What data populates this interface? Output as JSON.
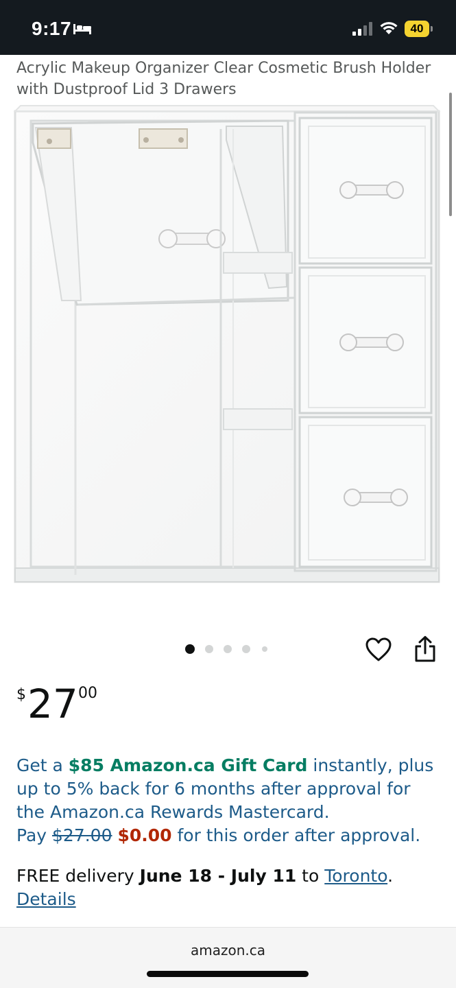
{
  "status_bar": {
    "time": "9:17",
    "battery": "40",
    "icons": [
      "bed-icon",
      "signal-icon",
      "wifi-icon",
      "battery-icon"
    ]
  },
  "product": {
    "title": "Acrylic Makeup Organizer Clear Cosmetic Brush Holder with Dustproof Lid 3 Drawers",
    "image_alt": "clear-acrylic-organizer-image",
    "carousel": {
      "total_dots": 5,
      "active_index": 0
    }
  },
  "price": {
    "symbol": "$",
    "whole": "27",
    "fraction": "00"
  },
  "promo": {
    "part1": "Get a ",
    "gift_card": "$85 Amazon.ca Gift Card",
    "part2": " instantly, plus up to 5% back for 6 months after approval for the Amazon.ca Rewards Mastercard.",
    "pay_label": "Pay ",
    "original_price": "$27.00",
    "new_price": "$0.00",
    "part3": " for this order after approval."
  },
  "delivery": {
    "free_label": "FREE delivery ",
    "dates": "June 18 - July 11",
    "to_label": " to ",
    "location": "Toronto",
    "period": ".",
    "details_link": "Details"
  },
  "footer": {
    "domain": "amazon.ca"
  },
  "colors": {
    "status_bar_bg": "#141a1f",
    "link_blue": "#1d5b89",
    "green": "#067d62",
    "red": "#b12704",
    "battery_yellow": "#f4d330"
  }
}
